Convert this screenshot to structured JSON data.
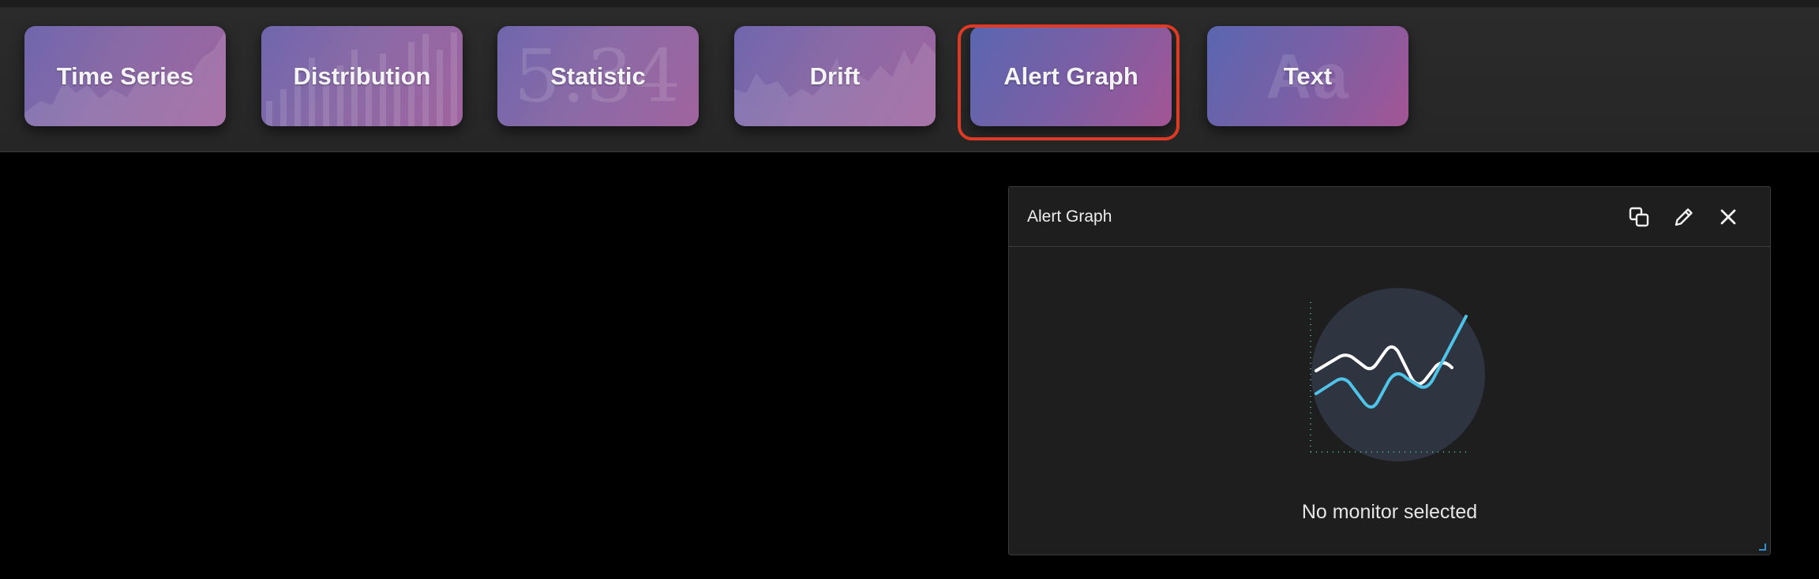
{
  "toolbar": {
    "cards": [
      {
        "label": "Time Series",
        "ghost": ""
      },
      {
        "label": "Distribution",
        "ghost": ""
      },
      {
        "label": "Statistic",
        "ghost": "5.34"
      },
      {
        "label": "Drift",
        "ghost": ""
      },
      {
        "label": "Alert Graph",
        "ghost": "",
        "selected": true
      },
      {
        "label": "Text",
        "ghost": "Aa"
      }
    ]
  },
  "panel": {
    "title": "Alert Graph",
    "empty_message": "No monitor selected",
    "actions": [
      "duplicate-icon",
      "edit-icon",
      "close-icon"
    ]
  },
  "colors": {
    "selection": "#e03a24",
    "accent_line": "#4fc3e8",
    "panel_bg": "#1e1e1e"
  }
}
